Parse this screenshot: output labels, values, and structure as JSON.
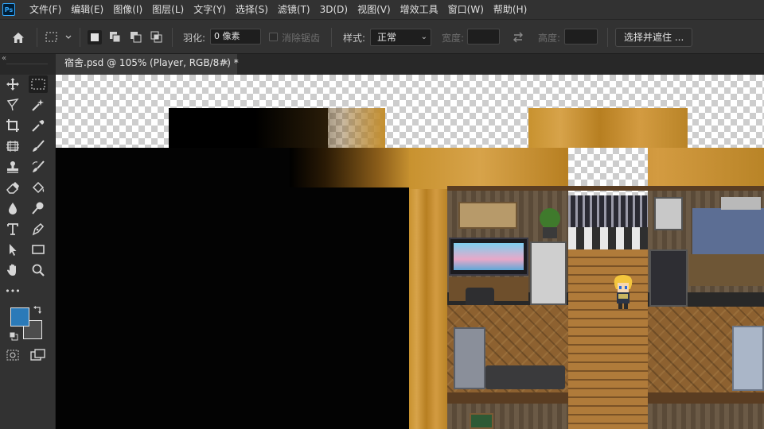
{
  "app": {
    "logo_text": "Ps"
  },
  "menu": {
    "items": [
      "文件(F)",
      "编辑(E)",
      "图像(I)",
      "图层(L)",
      "文字(Y)",
      "选择(S)",
      "滤镜(T)",
      "3D(D)",
      "视图(V)",
      "增效工具",
      "窗口(W)",
      "帮助(H)"
    ]
  },
  "options": {
    "feather_label": "羽化:",
    "feather_value": "0 像素",
    "antialias_label": "消除锯齿",
    "style_label": "样式:",
    "style_value": "正常",
    "width_label": "宽度:",
    "height_label": "高度:",
    "select_mask_label": "选择并遮住 ..."
  },
  "tabs": {
    "collapse_glyph": "«",
    "document_title": "宿舍.psd @ 105% (Player, RGB/8#) *",
    "close_glyph": "×"
  },
  "toolbar": {
    "more_glyph": "•••",
    "foreground_color": "#2b7ab8",
    "background_color": "#4d4d4d",
    "tools": [
      "move-tool",
      "rectangular-marquee-tool",
      "lasso-tool",
      "magic-wand-tool",
      "crop-tool",
      "eyedropper-tool",
      "frame-tool",
      "brush-tool",
      "clone-stamp-tool",
      "history-brush-tool",
      "eraser-tool",
      "paint-bucket-tool",
      "blur-tool",
      "dodge-tool",
      "type-tool",
      "pen-tool",
      "path-selection-tool",
      "rectangle-tool",
      "hand-tool",
      "zoom-tool"
    ]
  },
  "canvas": {
    "description_colors": {
      "wall": "#c8922f",
      "void": "#030303"
    }
  }
}
